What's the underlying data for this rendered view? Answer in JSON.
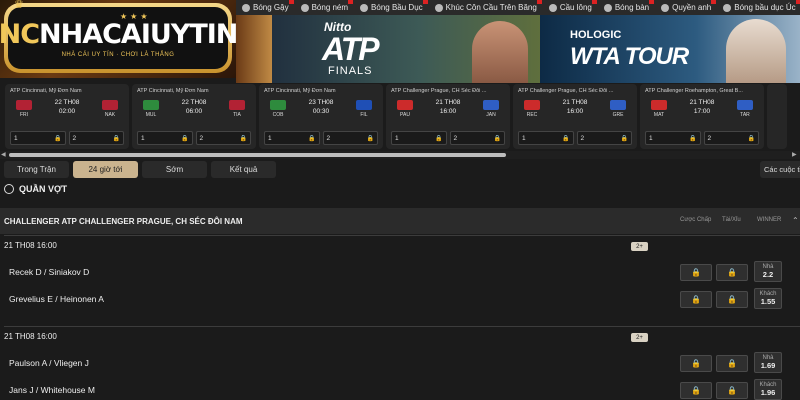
{
  "nav": {
    "items": [
      {
        "label": "Bóng Gậy",
        "icon": "bat-icon"
      },
      {
        "label": "Bóng ném",
        "icon": "handball-icon"
      },
      {
        "label": "Bóng Bầu Dục",
        "icon": "rugby-icon"
      },
      {
        "label": "Khúc Côn Cầu Trên Băng",
        "icon": "ice-hockey-icon"
      },
      {
        "label": "Cầu lông",
        "icon": "badminton-icon"
      },
      {
        "label": "Bóng bàn",
        "icon": "table-tennis-icon"
      },
      {
        "label": "Quyền anh",
        "icon": "boxing-icon"
      },
      {
        "label": "Bóng bầu dục Úc",
        "icon": "aussie-rules-icon"
      }
    ]
  },
  "logo": {
    "prefix": "NC",
    "name": "NHACAIUYTIN",
    "tagline": "NHÀ CÁI UY TÍN · CHƠI LÀ THẮNG"
  },
  "banners": {
    "atp": {
      "brand": "Nitto",
      "title": "ATP",
      "subtitle": "FINALS"
    },
    "wta": {
      "brand": "HOLOGIC",
      "title": "WTA TOUR"
    }
  },
  "cards": [
    {
      "league": "ATP Cincinnati, Mỹ Đơn Nam",
      "home": "FRI",
      "away": "NAK",
      "date": "22 TH08",
      "time": "02:00",
      "home_color": "#b22234",
      "away_color": "#b22234",
      "odd1": "1",
      "odd2": "2"
    },
    {
      "league": "ATP Cincinnati, Mỹ Đơn Nam",
      "home": "MUL",
      "away": "TIA",
      "date": "22 TH08",
      "time": "06:00",
      "home_color": "#2e8b3d",
      "away_color": "#b22234",
      "odd1": "1",
      "odd2": "2"
    },
    {
      "league": "ATP Cincinnati, Mỹ Đơn Nam",
      "home": "COB",
      "away": "FIL",
      "date": "23 TH08",
      "time": "00:30",
      "home_color": "#2e8b3d",
      "away_color": "#1f4fb5",
      "odd1": "1",
      "odd2": "2"
    },
    {
      "league": "ATP Challenger Prague, CH Séc Đôi ...",
      "home": "PAU",
      "away": "JAN",
      "date": "21 TH08",
      "time": "16:00",
      "home_color": "#cc2b2b",
      "away_color": "#2f5ec4",
      "odd1": "1",
      "odd2": "2"
    },
    {
      "league": "ATP Challenger Prague, CH Séc Đôi ...",
      "home": "REC",
      "away": "GRE",
      "date": "21 TH08",
      "time": "16:00",
      "home_color": "#cc2b2b",
      "away_color": "#2f5ec4",
      "odd1": "1",
      "odd2": "2"
    },
    {
      "league": "ATP Challenger Roehampton, Great B...",
      "home": "MAT",
      "away": "TAR",
      "date": "21 TH08",
      "time": "17:00",
      "home_color": "#cc2b2b",
      "away_color": "#2f5ec4",
      "odd1": "1",
      "odd2": "2"
    }
  ],
  "tabs": [
    {
      "label": "Trong Trận",
      "active": false
    },
    {
      "label": "24 giờ tới",
      "active": true
    },
    {
      "label": "Sớm",
      "active": false
    },
    {
      "label": "Kết quả",
      "active": false
    }
  ],
  "more_tab": "Các cuộc tỉ",
  "sport_title": "QUẦN VỢT",
  "league_title": "CHALLENGER ATP CHALLENGER PRAGUE, CH SÉC ĐÔI NAM",
  "columns": {
    "handicap": "Cược Chấp",
    "over_under": "Tài/Xỉu",
    "winner": "WINNER"
  },
  "matches": [
    {
      "time": "21 TH08 16:00",
      "badge": "2+",
      "home": "Recek D / Siniakov D",
      "away": "Grevelius E / Heinonen A",
      "home_label": "Nhà",
      "home_odd": "2.2",
      "away_label": "Khách",
      "away_odd": "1.55"
    },
    {
      "time": "21 TH08 16:00",
      "badge": "2+",
      "home": "Paulson A / Vliegen J",
      "away": "Jans J / Whitehouse M",
      "home_label": "Nhà",
      "home_odd": "1.69",
      "away_label": "Khách",
      "away_odd": "1.96"
    }
  ],
  "lock_glyph": "🔒"
}
